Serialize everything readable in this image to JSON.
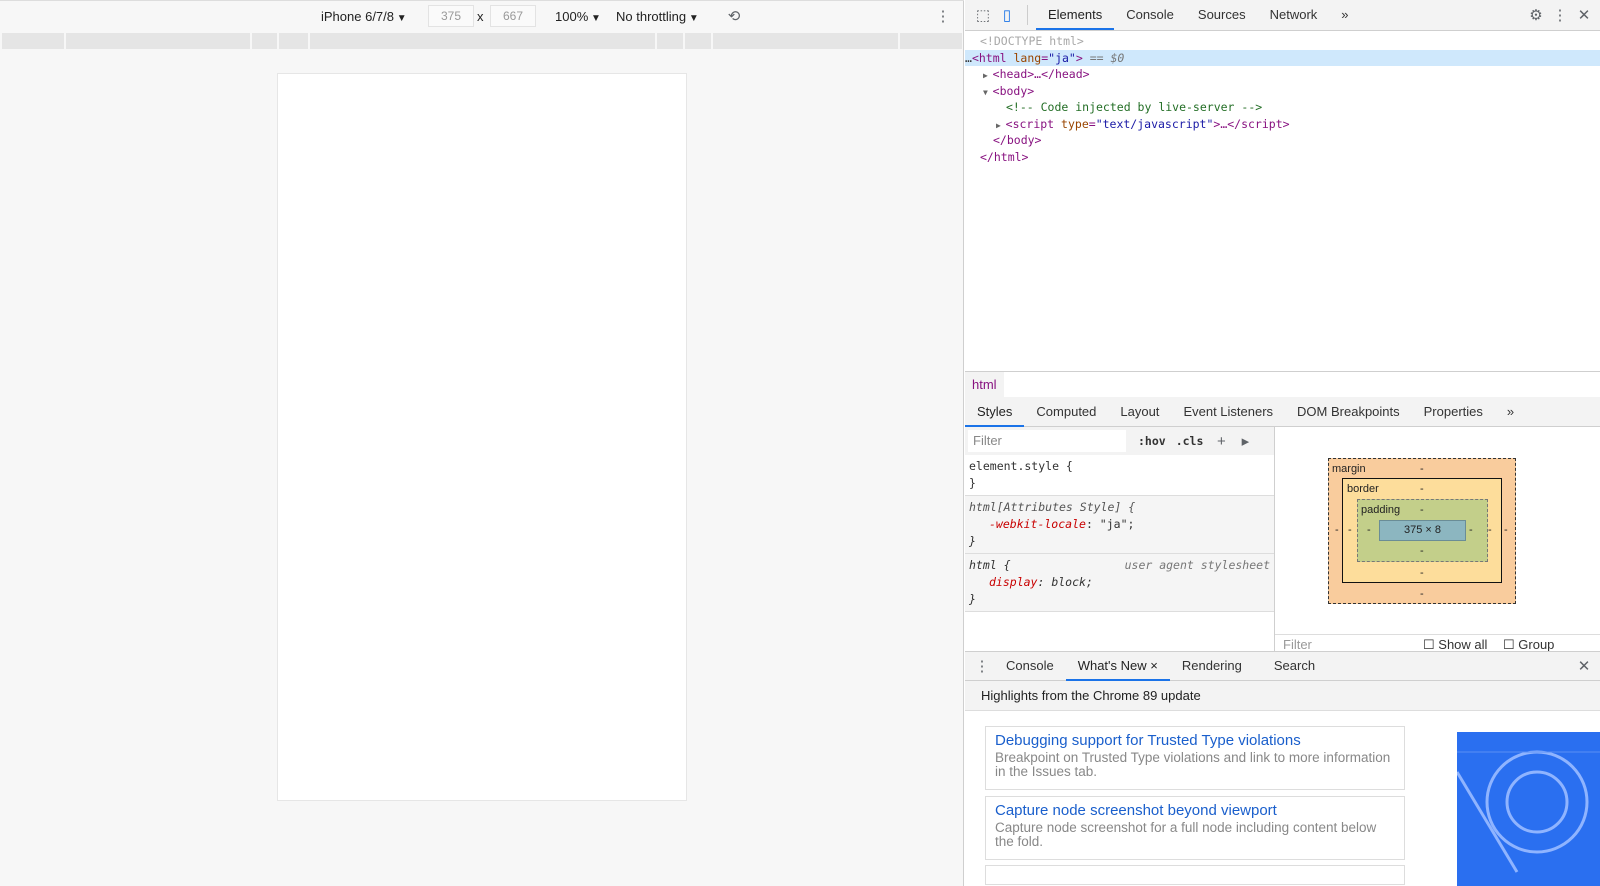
{
  "device_toolbar": {
    "device": "iPhone 6/7/8",
    "width": "375",
    "height": "667",
    "times": "x",
    "zoom": "100%",
    "throttling": "No throttling"
  },
  "devtools": {
    "tabs": [
      "Elements",
      "Console",
      "Sources",
      "Network"
    ],
    "more": "»",
    "dom": {
      "doctype": "<!DOCTYPE html>",
      "html_open": "<html",
      "html_attr": "lang",
      "html_val": "\"ja\"",
      "html_close": ">",
      "selected_marker": " == $0",
      "head": "<head>…</head>",
      "body_open": "<body>",
      "comment": "<!-- Code injected by live-server -->",
      "script_open": "<script",
      "script_attr": "type",
      "script_val": "\"text/javascript\"",
      "script_rest": ">…</script>",
      "body_close": "</body>",
      "html_end": "</html>"
    },
    "breadcrumb": "html",
    "style_tabs": [
      "Styles",
      "Computed",
      "Layout",
      "Event Listeners",
      "DOM Breakpoints",
      "Properties"
    ],
    "styles": {
      "filter_placeholder": "Filter",
      "hov": ":hov",
      "cls": ".cls",
      "rules": [
        {
          "selector": "element.style {",
          "props": [],
          "close": "}"
        },
        {
          "selector": "html[Attributes Style] {",
          "props": [
            {
              "name": "-webkit-locale",
              "value": "\"ja\";"
            }
          ],
          "close": "}"
        },
        {
          "selector": "html {",
          "origin": "user agent stylesheet",
          "props": [
            {
              "name": "display",
              "value": "block;"
            }
          ],
          "close": "}"
        }
      ]
    },
    "box_model": {
      "margin": "margin",
      "border": "border",
      "padding": "padding",
      "content": "375 × 8",
      "dash": "-"
    },
    "computed_filter": {
      "placeholder": "Filter",
      "show_all": "Show all",
      "group": "Group"
    },
    "drawer": {
      "tabs": [
        "Console",
        "What's New",
        "Rendering",
        "Search"
      ],
      "header": "Highlights from the Chrome 89 update",
      "cards": [
        {
          "title": "Debugging support for Trusted Type violations",
          "desc": "Breakpoint on Trusted Type violations and link to more information in the Issues tab."
        },
        {
          "title": "Capture node screenshot beyond viewport",
          "desc": "Capture node screenshot for a full node including content below the fold."
        }
      ]
    }
  }
}
